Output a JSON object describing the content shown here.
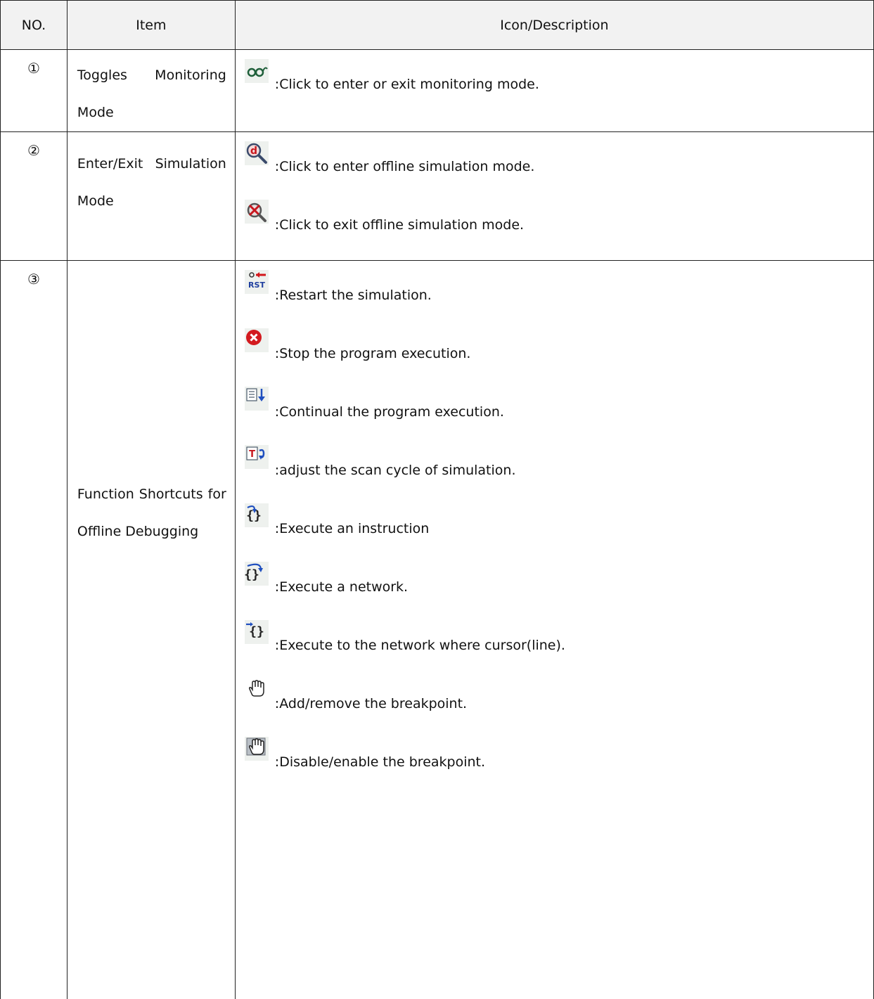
{
  "headers": {
    "no": "NO.",
    "item": "Item",
    "desc": "Icon/Description"
  },
  "rows": [
    {
      "no": "①",
      "item": "Toggles Monitoring Mode",
      "entries": [
        {
          "icon": "glasses-icon",
          "text": ":Click to enter or exit monitoring mode."
        }
      ]
    },
    {
      "no": "②",
      "item": "Enter/Exit Simulation Mode",
      "entries": [
        {
          "icon": "magnifier-d-icon",
          "text": ":Click to enter offline simulation mode."
        },
        {
          "icon": "magnifier-cross-icon",
          "text": ":Click to exit offline simulation mode."
        }
      ]
    },
    {
      "no": "③",
      "item": "Function Shortcuts for Offline Debugging",
      "entries": [
        {
          "icon": "rst-icon",
          "text": ":Restart the simulation."
        },
        {
          "icon": "stop-icon",
          "text": ":Stop the program execution."
        },
        {
          "icon": "continue-icon",
          "text": ":Continual the program execution."
        },
        {
          "icon": "scan-cycle-icon",
          "text": ":adjust the scan cycle of simulation."
        },
        {
          "icon": "step-into-icon",
          "text": ":Execute an instruction"
        },
        {
          "icon": "step-over-icon",
          "text": ":Execute a network."
        },
        {
          "icon": "run-to-cursor-icon",
          "text": ":Execute to the network where cursor(line)."
        },
        {
          "icon": "hand-icon",
          "text": ":Add/remove the breakpoint."
        },
        {
          "icon": "hand-disable-icon",
          "text": ":Disable/enable the breakpoint."
        }
      ]
    }
  ]
}
